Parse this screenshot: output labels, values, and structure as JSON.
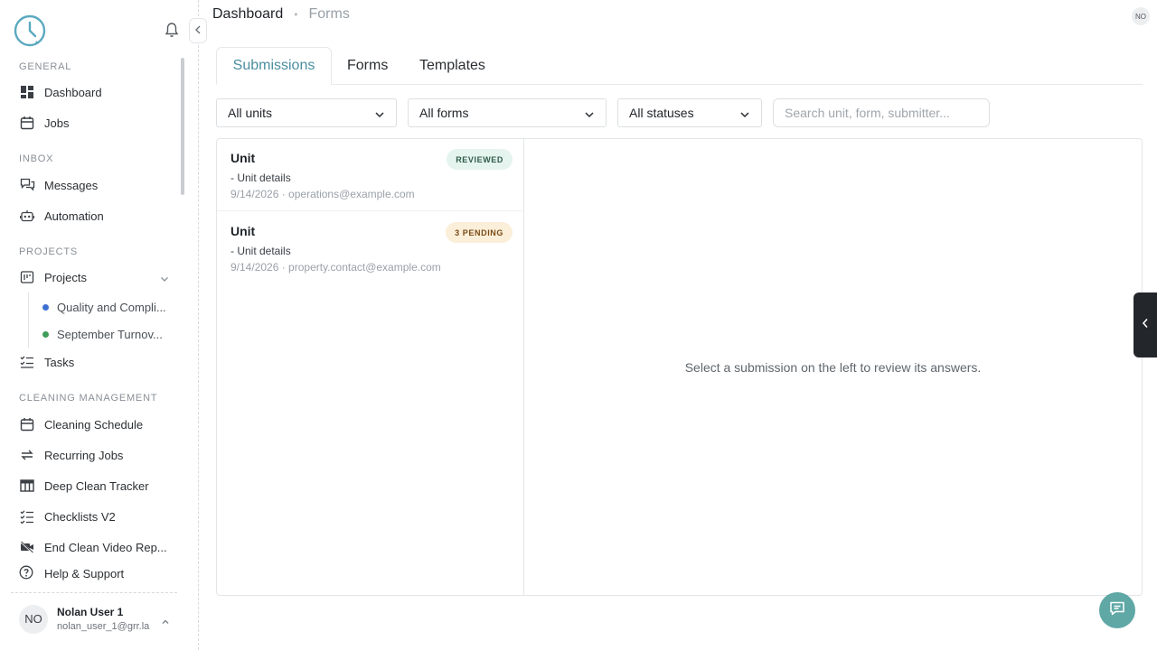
{
  "sidebar": {
    "sections": {
      "general": "GENERAL",
      "inbox": "INBOX",
      "projects": "PROJECTS",
      "cleaning": "CLEANING MANAGEMENT"
    },
    "items": {
      "dashboard": "Dashboard",
      "jobs": "Jobs",
      "messages": "Messages",
      "automation": "Automation",
      "projects": "Projects",
      "tasks": "Tasks",
      "cleaning_schedule": "Cleaning Schedule",
      "recurring_jobs": "Recurring Jobs",
      "deep_clean_tracker": "Deep Clean Tracker",
      "checklists_v2": "Checklists V2",
      "end_clean_video": "End Clean Video Rep...",
      "help": "Help & Support"
    },
    "subprojects": [
      {
        "label": "Quality and Compli...",
        "color": "#3f6fd1"
      },
      {
        "label": "September Turnov...",
        "color": "#3f9c5a"
      }
    ],
    "user": {
      "initials": "NO",
      "name": "Nolan User 1",
      "email": "nolan_user_1@grr.la"
    }
  },
  "header": {
    "breadcrumb_root": "Dashboard",
    "breadcrumb_sep": "•",
    "breadcrumb_current": "Forms",
    "avatar_initials": "NO"
  },
  "tabs": {
    "submissions": "Submissions",
    "forms": "Forms",
    "templates": "Templates"
  },
  "filters": {
    "units": "All units",
    "forms": "All forms",
    "statuses": "All statuses",
    "search_placeholder": "Search unit, form, submitter..."
  },
  "submissions": [
    {
      "title": "Unit",
      "subtitle": "- Unit details",
      "meta": "9/14/2026 · operations@example.com",
      "status": "REVIEWED"
    },
    {
      "title": "Unit",
      "subtitle": "- Unit details",
      "meta": "9/14/2026 · property.contact@example.com",
      "status": "3 PENDING"
    }
  ],
  "detail": {
    "empty_message": "Select a submission on the left to review its answers."
  },
  "colors": {
    "accent": "#4a8ea0",
    "chat_button": "#5fa8a6",
    "reviewed_bg": "#e5f4ee",
    "pending_bg": "#fbefd9"
  }
}
